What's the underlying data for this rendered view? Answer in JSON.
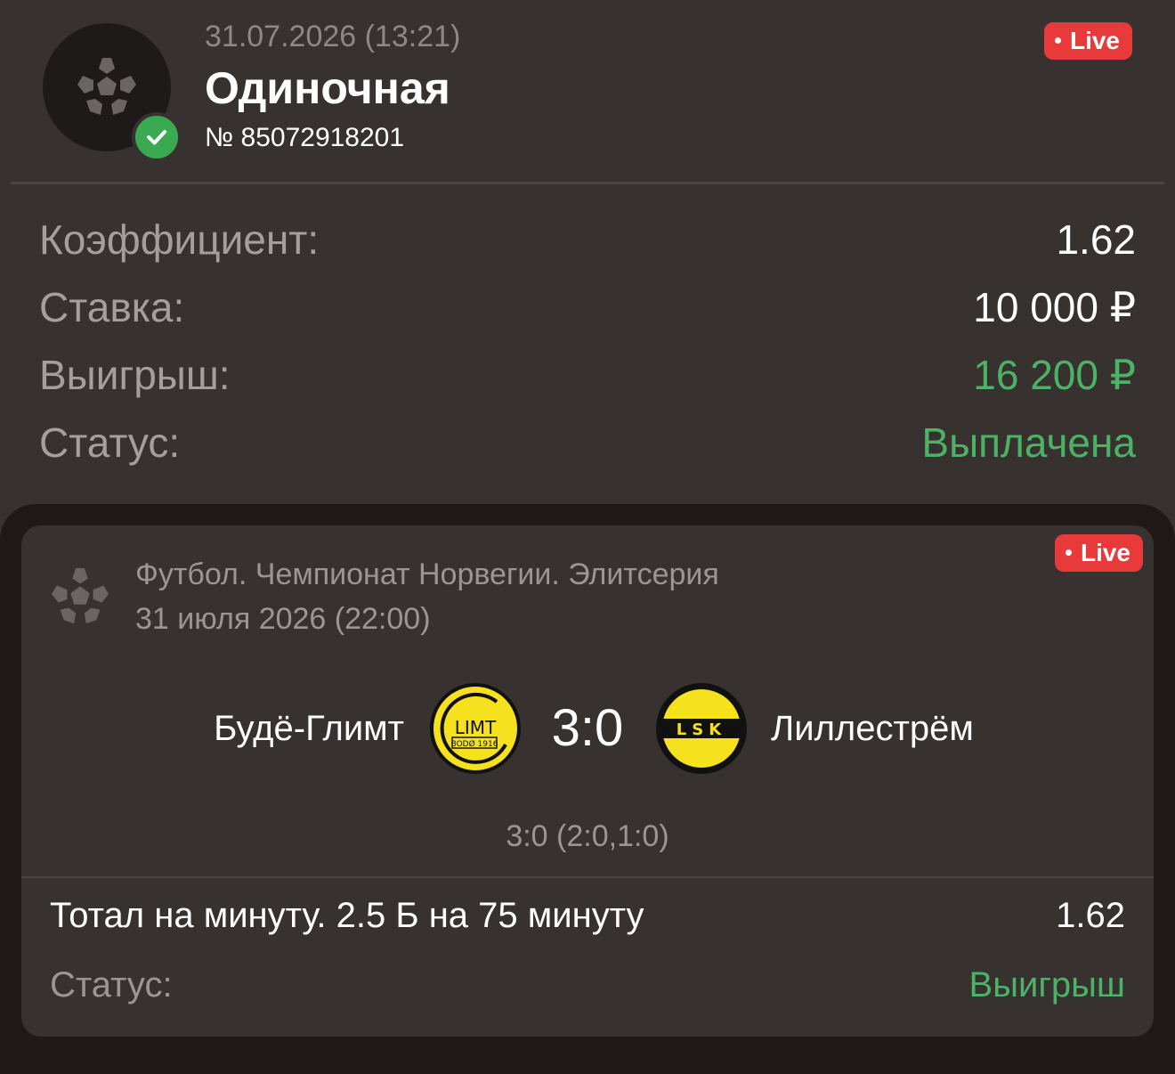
{
  "header": {
    "datetime": "31.07.2026 (13:21)",
    "bet_type": "Одиночная",
    "bet_number": "№ 85072918201",
    "live_badge": "Live",
    "icon": "soccer-ball-icon",
    "status_icon": "check-icon"
  },
  "summary": {
    "odds_label": "Коэффициент:",
    "odds_value": "1.62",
    "stake_label": "Ставка:",
    "stake_value": "10 000 ₽",
    "win_label": "Выигрыш:",
    "win_value": "16 200 ₽",
    "status_label": "Статус:",
    "status_value": "Выплачена"
  },
  "event": {
    "live_badge": "Live",
    "league": "Футбол. Чемпионат Норвегии. Элитсерия",
    "date": "31 июля 2026 (22:00)",
    "home_team": "Будё-Глимт",
    "away_team": "Лиллестрём",
    "score": "3:0",
    "score_detail": "3:0 (2:0,1:0)",
    "home_logo_text": "LIMT",
    "home_logo_sub": "BODØ 1916",
    "away_logo_text": "LSK"
  },
  "selection": {
    "market": "Тотал на минуту. 2.5 Б на 75 минуту",
    "odds": "1.62",
    "status_label": "Статус:",
    "status_value": "Выигрыш"
  },
  "colors": {
    "background": "#373130",
    "card_outer": "#1e1918",
    "accent_green": "#4cb266",
    "live_red": "#e83a3a",
    "check_green": "#3aaa51",
    "logo_yellow": "#f5e11e"
  }
}
